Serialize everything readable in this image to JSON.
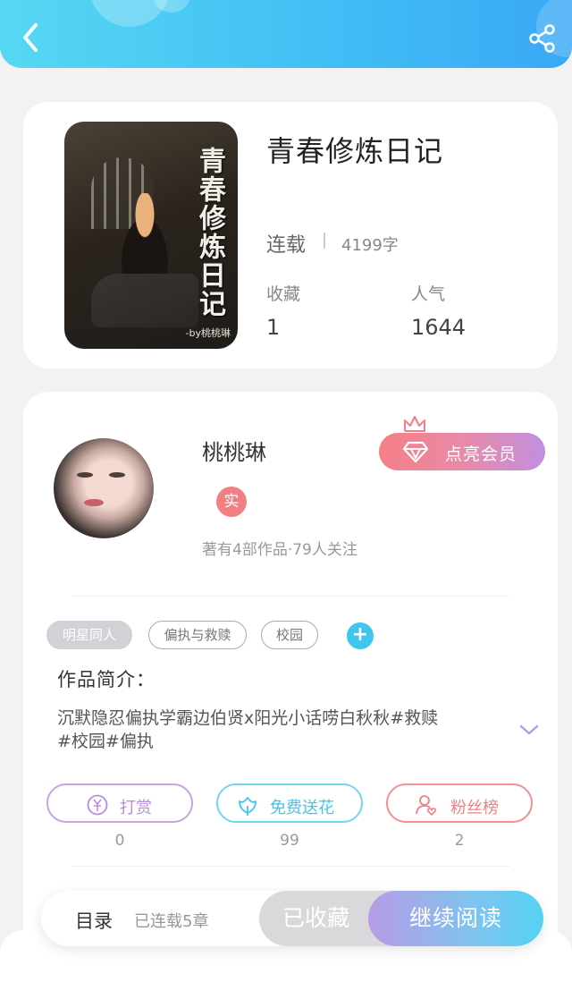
{
  "header": {
    "back_icon": "chevron-left-icon",
    "share_icon": "share-icon"
  },
  "book": {
    "title": "青春修炼日记",
    "cover_title": "青春修炼日记",
    "cover_by": "-by桃桃琳",
    "status": "连载",
    "word_count": "4199字",
    "stats": [
      {
        "label": "收藏",
        "value": "1"
      },
      {
        "label": "人气",
        "value": "1644"
      }
    ]
  },
  "author": {
    "name": "桃桃琳",
    "verified_badge": "实",
    "meta": "著有4部作品·79人关注",
    "vip_button": "点亮会员"
  },
  "tags": [
    "明星同人",
    "偏执与救赎",
    "校园"
  ],
  "intro": {
    "label": "作品简介：",
    "text": "沉默隐忍偏执学霸边伯贤x阳光小话唠白秋秋#救赎#校园#偏执"
  },
  "actions": [
    {
      "label": "打赏",
      "count": "0",
      "icon": "yen-coin-icon",
      "color": "#b78cde"
    },
    {
      "label": "免费送花",
      "count": "99",
      "icon": "flower-icon",
      "color": "#3ec6ef"
    },
    {
      "label": "粉丝榜",
      "count": "2",
      "icon": "fan-heart-icon",
      "color": "#f27f84"
    }
  ],
  "bottom_bar": {
    "toc": "目录",
    "chapters": "已连载5章",
    "collected": "已收藏",
    "read": "继续阅读"
  }
}
